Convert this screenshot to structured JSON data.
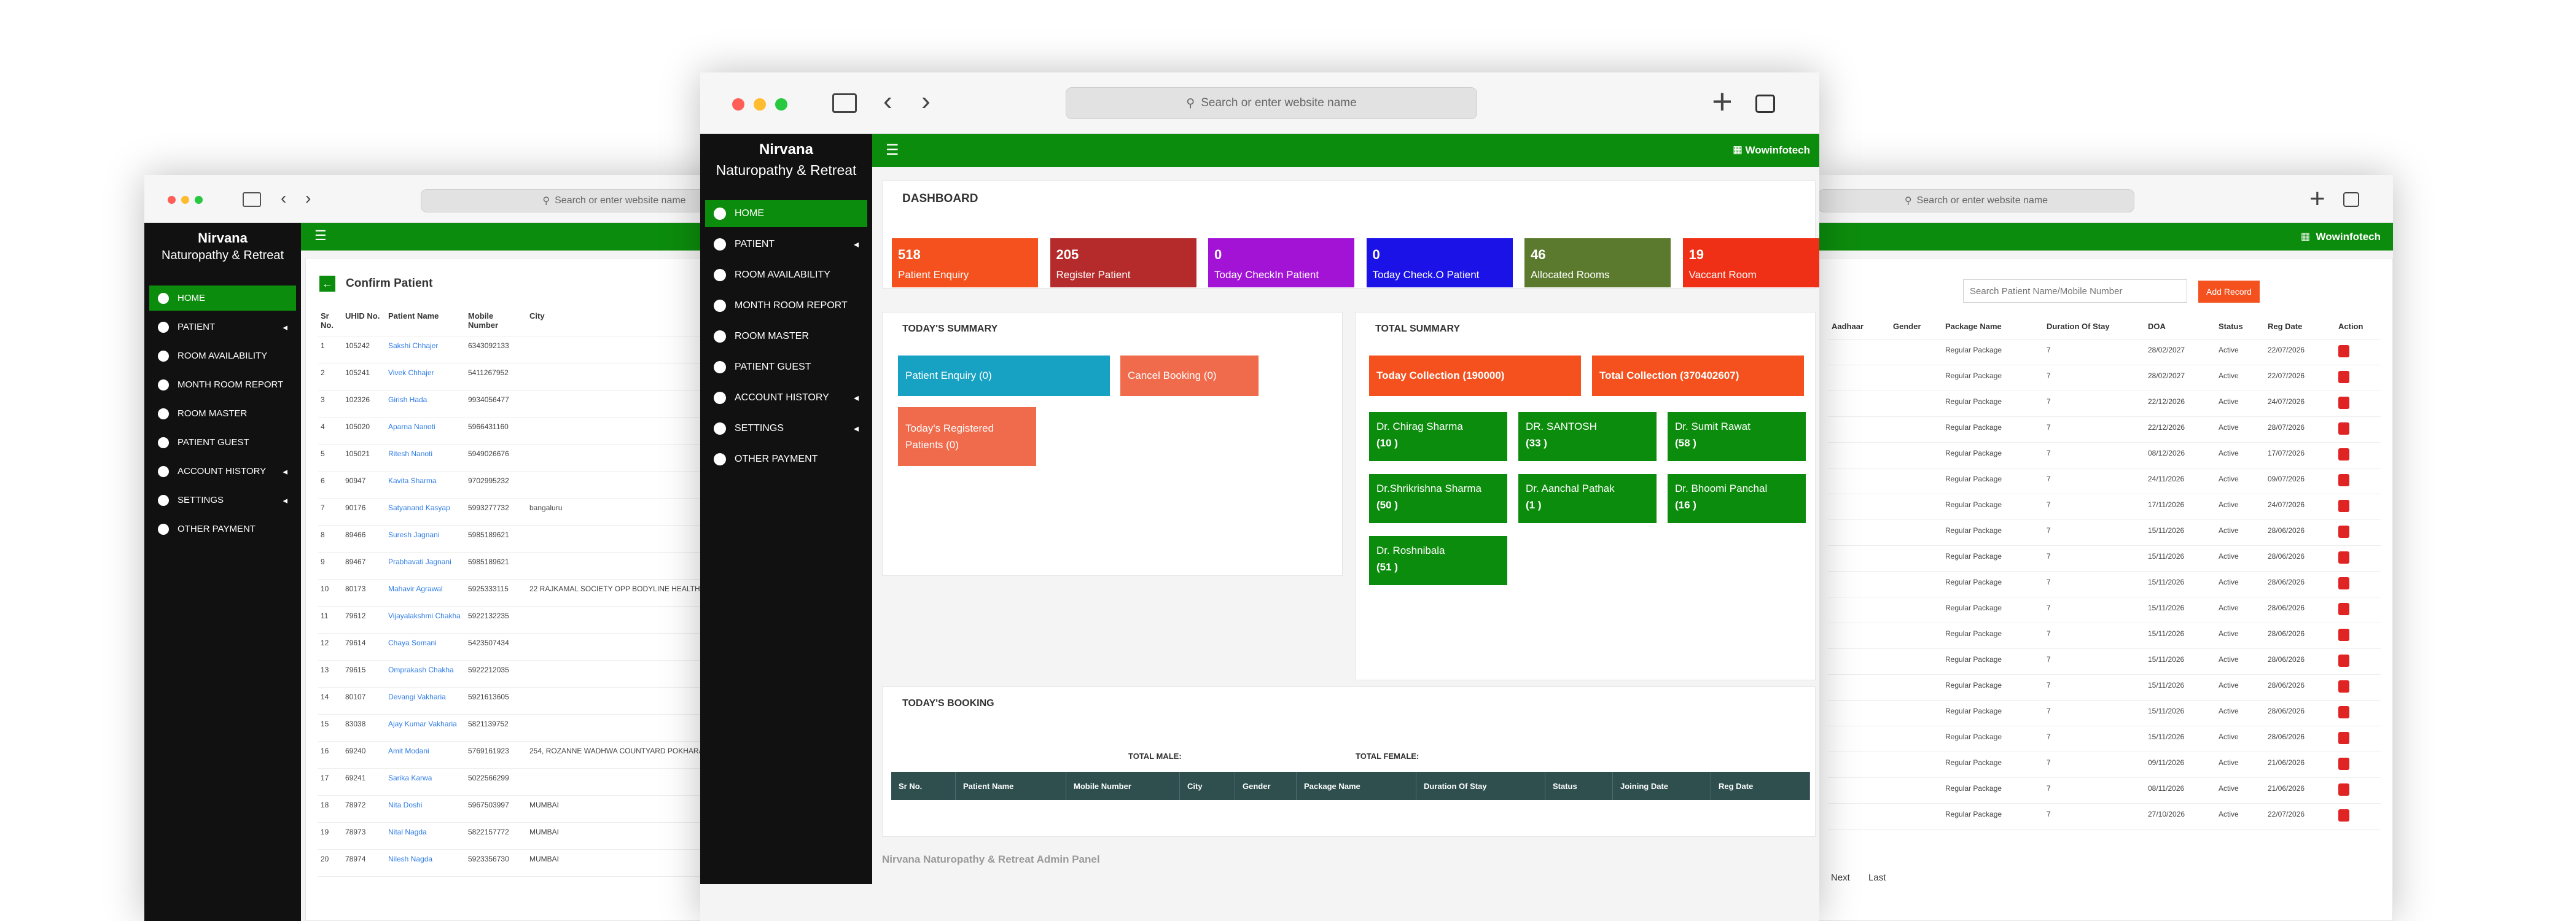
{
  "brand": {
    "line1": "Nirvana",
    "line2": "Naturopathy & Retreat"
  },
  "addressbar": {
    "placeholder": "Search or enter website name"
  },
  "topbar": {
    "menu_icon": "hamburger-icon",
    "brand_right": "Wowinfotech"
  },
  "sidebar": {
    "items": [
      {
        "label": "HOME",
        "active": true,
        "chevron": false
      },
      {
        "label": "PATIENT",
        "active": false,
        "chevron": true
      },
      {
        "label": "ROOM AVAILABILITY",
        "active": false,
        "chevron": false
      },
      {
        "label": "MONTH ROOM REPORT",
        "active": false,
        "chevron": false
      },
      {
        "label": "ROOM MASTER",
        "active": false,
        "chevron": false
      },
      {
        "label": "PATIENT GUEST",
        "active": false,
        "chevron": false
      },
      {
        "label": "ACCOUNT HISTORY",
        "active": false,
        "chevron": true
      },
      {
        "label": "SETTINGS",
        "active": false,
        "chevron": true
      },
      {
        "label": "OTHER PAYMENT",
        "active": false,
        "chevron": false
      }
    ]
  },
  "dashboard": {
    "title": "DASHBOARD",
    "tiles": [
      {
        "value": "518",
        "label": "Patient Enquiry",
        "color": "#f4511e"
      },
      {
        "value": "205",
        "label": "Register Patient",
        "color": "#b52b2b"
      },
      {
        "value": "0",
        "label": "Today CheckIn Patient",
        "color": "#a313d6"
      },
      {
        "value": "0",
        "label": "Today Check.O Patient",
        "color": "#1b12e8"
      },
      {
        "value": "46",
        "label": "Allocated Rooms",
        "color": "#5b7a2e"
      },
      {
        "value": "19",
        "label": "Vaccant Room",
        "color": "#ef2f16"
      }
    ],
    "today_summary": {
      "title": "TODAY'S SUMMARY",
      "patient_enquiry": "Patient Enquiry (0)",
      "cancel_booking": "Cancel Booking (0)",
      "registered": "Today's Registered Patients (0)"
    },
    "total_summary": {
      "title": "TOTAL SUMMARY",
      "today_collection": "Today Collection (190000)",
      "total_collection": "Total Collection (370402607)",
      "doctors": [
        {
          "name": "Dr. Chirag Sharma",
          "count": "(10 )"
        },
        {
          "name": "DR. SANTOSH",
          "count": "(33 )"
        },
        {
          "name": "Dr. Sumit Rawat",
          "count": "(58 )"
        },
        {
          "name": "Dr.Shrikrishna Sharma",
          "count": "(50 )"
        },
        {
          "name": "Dr. Aanchal Pathak",
          "count": "(1 )"
        },
        {
          "name": "Dr. Bhoomi Panchal",
          "count": "(16 )"
        },
        {
          "name": "Dr. Roshnibala",
          "count": "(51 )"
        }
      ]
    },
    "booking": {
      "title": "TODAY'S BOOKING",
      "total_male": "TOTAL MALE:",
      "total_female": "TOTAL FEMALE:",
      "columns": [
        "Sr No.",
        "Patient Name",
        "Mobile Number",
        "City",
        "Gender",
        "Package Name",
        "Duration Of Stay",
        "Status",
        "Joining Date",
        "Reg Date"
      ]
    },
    "footer": "Nirvana Naturopathy & Retreat Admin Panel"
  },
  "confirm": {
    "title": "Confirm Patient",
    "columns": [
      "Sr No.",
      "UHID No.",
      "Patient Name",
      "Mobile Number",
      "City"
    ],
    "rows": [
      [
        "1",
        "105242",
        "Sakshi Chhajer",
        "6343092133",
        ""
      ],
      [
        "2",
        "105241",
        "Vivek Chhajer",
        "5411267952",
        ""
      ],
      [
        "3",
        "102326",
        "Girish Hada",
        "9934056477",
        ""
      ],
      [
        "4",
        "105020",
        "Aparna Nanoti",
        "5966431160",
        ""
      ],
      [
        "5",
        "105021",
        "Ritesh Nanoti",
        "5949026676",
        ""
      ],
      [
        "6",
        "90947",
        "Kavita Sharma",
        "9702995232",
        ""
      ],
      [
        "7",
        "90176",
        "Satyanand Kasyap",
        "5993277732",
        "bangaluru"
      ],
      [
        "8",
        "89466",
        "Suresh Jagnani",
        "5985189621",
        ""
      ],
      [
        "9",
        "89467",
        "Prabhavati Jagnani",
        "5985189621",
        ""
      ],
      [
        "10",
        "80173",
        "Mahavir Agrawal",
        "5925333115",
        "22 RAJKAMAL SOCIETY OPP BODYLINE HEALTH C..."
      ],
      [
        "11",
        "79612",
        "Vijayalakshmi Chakha",
        "5922132235",
        ""
      ],
      [
        "12",
        "79614",
        "Chaya Somani",
        "5423507434",
        ""
      ],
      [
        "13",
        "79615",
        "Omprakash Chakha",
        "5922212035",
        ""
      ],
      [
        "14",
        "80107",
        "Devangi Vakharia",
        "5921613605",
        ""
      ],
      [
        "15",
        "83038",
        "Ajay Kumar Vakharia",
        "5821139752",
        ""
      ],
      [
        "16",
        "69240",
        "Amit Modani",
        "5769161923",
        "254, ROZANNE WADHWA COUNTYARD POKHARAN VIHAR THANE"
      ],
      [
        "17",
        "69241",
        "Sarika Karwa",
        "5022566299",
        ""
      ],
      [
        "18",
        "78972",
        "Nita Doshi",
        "5967503997",
        "MUMBAI"
      ],
      [
        "19",
        "78973",
        "Nital Nagda",
        "5822157772",
        "MUMBAI"
      ],
      [
        "20",
        "78974",
        "Nilesh Nagda",
        "5923356730",
        "MUMBAI"
      ]
    ]
  },
  "register": {
    "search_placeholder": "Search Patient Name/Mobile Number",
    "add_record": "Add Record",
    "columns": [
      "Aadhaar",
      "Gender",
      "Package Name",
      "Duration Of Stay",
      "DOA",
      "Status",
      "Reg Date",
      "Action"
    ],
    "rows": [
      [
        "",
        "",
        "Regular Package",
        "7",
        "28/02/2027",
        "Active",
        "22/07/2026"
      ],
      [
        "",
        "",
        "Regular Package",
        "7",
        "28/02/2027",
        "Active",
        "22/07/2026"
      ],
      [
        "",
        "",
        "Regular Package",
        "7",
        "22/12/2026",
        "Active",
        "24/07/2026"
      ],
      [
        "",
        "",
        "Regular Package",
        "7",
        "22/12/2026",
        "Active",
        "28/07/2026"
      ],
      [
        "",
        "",
        "Regular Package",
        "7",
        "08/12/2026",
        "Active",
        "17/07/2026"
      ],
      [
        "",
        "",
        "Regular Package",
        "7",
        "24/11/2026",
        "Active",
        "09/07/2026"
      ],
      [
        "",
        "",
        "Regular Package",
        "7",
        "17/11/2026",
        "Active",
        "24/07/2026"
      ],
      [
        "",
        "",
        "Regular Package",
        "7",
        "15/11/2026",
        "Active",
        "28/06/2026"
      ],
      [
        "",
        "",
        "Regular Package",
        "7",
        "15/11/2026",
        "Active",
        "28/06/2026"
      ],
      [
        "",
        "",
        "Regular Package",
        "7",
        "15/11/2026",
        "Active",
        "28/06/2026"
      ],
      [
        "",
        "",
        "Regular Package",
        "7",
        "15/11/2026",
        "Active",
        "28/06/2026"
      ],
      [
        "",
        "",
        "Regular Package",
        "7",
        "15/11/2026",
        "Active",
        "28/06/2026"
      ],
      [
        "",
        "",
        "Regular Package",
        "7",
        "15/11/2026",
        "Active",
        "28/06/2026"
      ],
      [
        "",
        "",
        "Regular Package",
        "7",
        "15/11/2026",
        "Active",
        "28/06/2026"
      ],
      [
        "",
        "",
        "Regular Package",
        "7",
        "15/11/2026",
        "Active",
        "28/06/2026"
      ],
      [
        "",
        "",
        "Regular Package",
        "7",
        "15/11/2026",
        "Active",
        "28/06/2026"
      ],
      [
        "",
        "",
        "Regular Package",
        "7",
        "09/11/2026",
        "Active",
        "21/06/2026"
      ],
      [
        "",
        "",
        "Regular Package",
        "7",
        "08/11/2026",
        "Active",
        "21/06/2026"
      ],
      [
        "",
        "",
        "Regular Package",
        "7",
        "27/10/2026",
        "Active",
        "22/07/2026"
      ]
    ],
    "pager": {
      "next": "Next",
      "last": "Last"
    }
  },
  "colors": {
    "green": "#0c8c0c",
    "sidebar": "#111111",
    "cyan": "#17a2c4",
    "salmon": "#f06a4c",
    "orange": "#f4511e",
    "teal_header": "#2f4f4f"
  }
}
